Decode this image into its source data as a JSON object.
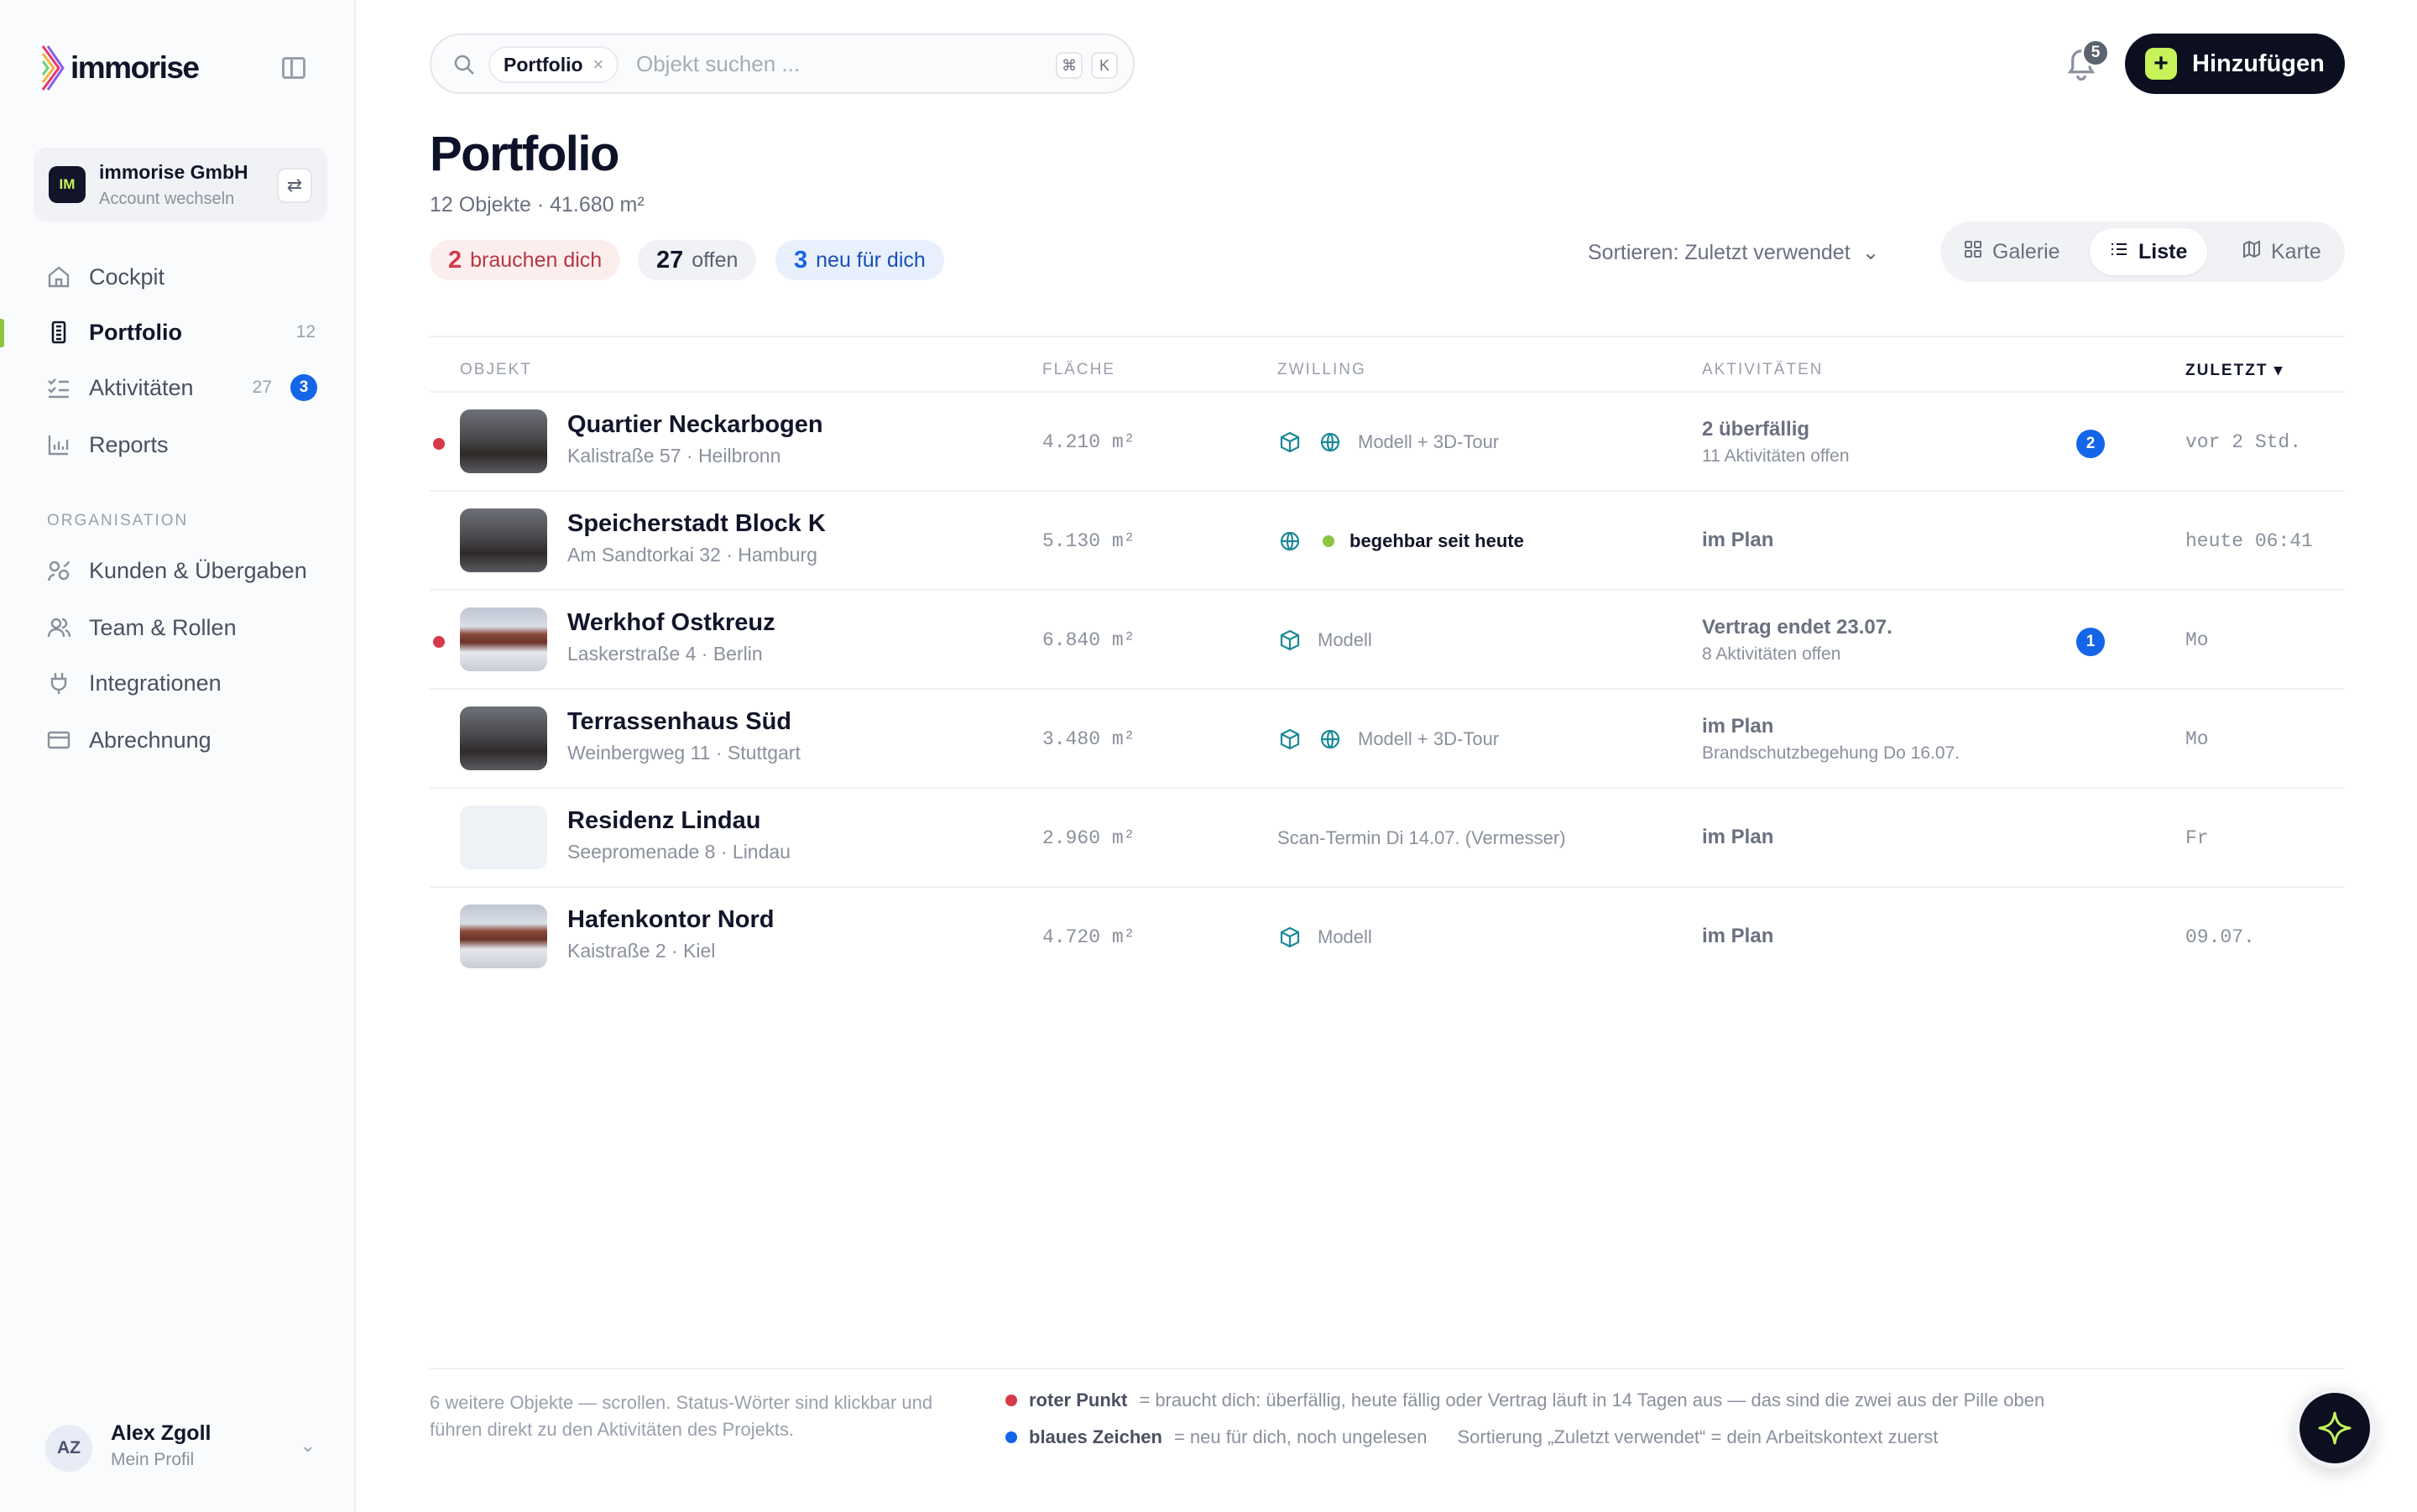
{
  "brand": {
    "name": "immorise"
  },
  "account": {
    "initials": "IM",
    "name": "immorise GmbH",
    "subtitle": "Account wechseln"
  },
  "nav": [
    {
      "label": "Cockpit",
      "icon": "home-icon"
    },
    {
      "label": "Portfolio",
      "icon": "building-icon",
      "count": "12",
      "active": true
    },
    {
      "label": "Aktivitäten",
      "icon": "checklist-icon",
      "count": "27",
      "badge": "3"
    },
    {
      "label": "Reports",
      "icon": "chart-icon"
    }
  ],
  "nav_section": "ORGANISATION",
  "nav_org": [
    {
      "label": "Kunden & Übergaben",
      "icon": "handover-icon"
    },
    {
      "label": "Team & Rollen",
      "icon": "users-icon"
    },
    {
      "label": "Integrationen",
      "icon": "plug-icon"
    },
    {
      "label": "Abrechnung",
      "icon": "credit-card-icon"
    }
  ],
  "profile": {
    "initials": "AZ",
    "name": "Alex Zgoll",
    "subtitle": "Mein Profil"
  },
  "search": {
    "chip": "Portfolio",
    "placeholder": "Objekt suchen ...",
    "kbd1": "⌘",
    "kbd2": "K"
  },
  "notifications": {
    "count": "5"
  },
  "add_button": "Hinzufügen",
  "page": {
    "title": "Portfolio",
    "subtitle": "12 Objekte · 41.680 m²",
    "pills": {
      "red": {
        "num": "2",
        "label": "brauchen dich"
      },
      "gray": {
        "num": "27",
        "label": "offen"
      },
      "blue": {
        "num": "3",
        "label": "neu für dich"
      }
    },
    "sort_label": "Sortieren: Zuletzt verwendet",
    "views": [
      "Galerie",
      "Liste",
      "Karte"
    ],
    "active_view": "Liste"
  },
  "table": {
    "headers": {
      "objekt": "OBJEKT",
      "flaeche": "FLÄCHE",
      "zwilling": "ZWILLING",
      "aktivitaeten": "AKTIVITÄTEN",
      "zuletzt": "ZULETZT ▾"
    },
    "rows": [
      {
        "title": "Quartier Neckarbogen",
        "address": "Kalistraße 57 · Heilbronn",
        "area": "4.210 m²",
        "twin": "Modell + 3D-Tour",
        "act_main": "2 überfällig",
        "act_sub": "11 Aktivitäten offen",
        "badge": "2",
        "last": "vor 2 Std.",
        "needs_you": true,
        "thumb": "dark"
      },
      {
        "title": "Speicherstadt Block K",
        "address": "Am Sandtorkai 32 · Hamburg",
        "area": "5.130 m²",
        "twin": "begehbar seit heute",
        "act_main": "im Plan",
        "act_sub": "",
        "badge": "",
        "last": "heute 06:41",
        "needs_you": false,
        "thumb": "dark"
      },
      {
        "title": "Werkhof Ostkreuz",
        "address": "Laskerstraße 4 · Berlin",
        "area": "6.840 m²",
        "twin": "Modell",
        "act_main": "Vertrag endet 23.07.",
        "act_sub": "8 Aktivitäten offen",
        "badge": "1",
        "last": "Mo",
        "needs_you": true,
        "thumb": "house"
      },
      {
        "title": "Terrassenhaus Süd",
        "address": "Weinbergweg 11 · Stuttgart",
        "area": "3.480 m²",
        "twin": "Modell + 3D-Tour",
        "act_main": "im Plan",
        "act_sub": "Brandschutzbegehung Do 16.07.",
        "badge": "",
        "last": "Mo",
        "needs_you": false,
        "thumb": "dark"
      },
      {
        "title": "Residenz Lindau",
        "address": "Seepromenade 8 · Lindau",
        "area": "2.960 m²",
        "twin": "Scan-Termin Di 14.07. (Vermesser)",
        "act_main": "im Plan",
        "act_sub": "",
        "badge": "",
        "last": "Fr",
        "needs_you": false,
        "thumb": "empty"
      },
      {
        "title": "Hafenkontor Nord",
        "address": "Kaistraße 2 · Kiel",
        "area": "4.720 m²",
        "twin": "Modell",
        "act_main": "im Plan",
        "act_sub": "",
        "badge": "",
        "last": "09.07.",
        "needs_you": false,
        "thumb": "house"
      }
    ]
  },
  "footer": {
    "note": "6 weitere Objekte — scrollen. Status-Wörter sind klickbar und führen direkt zu den Aktivitäten des Projekts.",
    "legend_red_label": "roter Punkt",
    "legend_red_text": "= braucht dich: überfällig, heute fällig oder Vertrag läuft in 14 Tagen aus — das sind die zwei aus der Pille oben",
    "legend_blue_label": "blaues Zeichen",
    "legend_blue_text": "= neu für dich, noch ungelesen",
    "legend_sort_text": "Sortierung „Zuletzt verwendet“ = dein Arbeitskontext zuerst"
  },
  "colors": {
    "accent": "#c6f25a",
    "danger": "#d63a4a",
    "info": "#1565e8",
    "twin": "#1b8a96",
    "ok": "#8bc53f"
  }
}
